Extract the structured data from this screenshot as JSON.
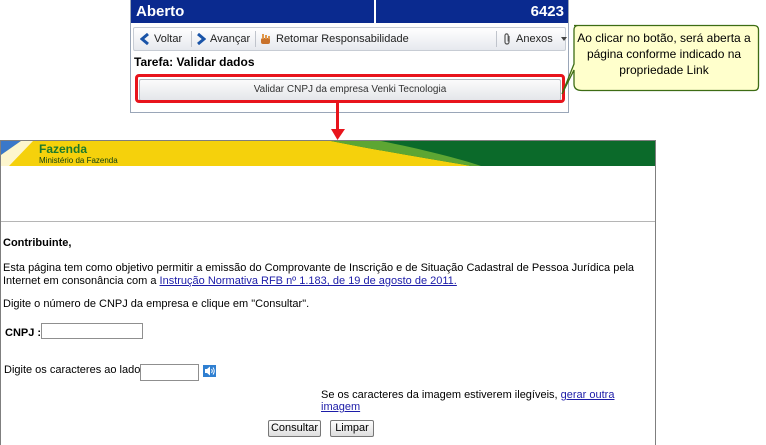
{
  "status": {
    "state": "Aberto",
    "number": "6423"
  },
  "toolbar": {
    "back_label": "Voltar",
    "forward_label": "Avançar",
    "resume_label": "Retomar Responsabilidade",
    "attachments_label": "Anexos"
  },
  "task": {
    "title": "Tarefa: Validar dados",
    "link_button_label": "Validar CNPJ da empresa Venki Tecnologia"
  },
  "callout": {
    "text": "Ao clicar no botão, será aberta a página conforme indicado na propriedade Link"
  },
  "gov": {
    "brand": "Fazenda",
    "ministry": "Ministério da Fazenda",
    "greeting": "Contribuinte,",
    "intro_before": "Esta página tem como objetivo permitir a emissão do Comprovante de Inscrição e de Situação Cadastral de Pessoa Jurídica pela Internet em consonância com a ",
    "intro_link": "Instrução Normativa RFB nº 1.183, de 19 de agosto de 2011.",
    "instruction": "Digite o número de CNPJ da empresa e clique em \"Consultar\".",
    "cnpj_label": "CNPJ :",
    "cnpj_value": "",
    "captcha_label": "Digite os caracteres ao lado:",
    "captcha_value": "",
    "illegible_text": "Se os caracteres da imagem estiverem ilegíveis, ",
    "illegible_link": "gerar outra imagem",
    "consultar_label": "Consultar",
    "limpar_label": "Limpar"
  },
  "colors": {
    "status_bar": "#0a2a8f",
    "highlight": "#e8141c",
    "callout_bg": "#ffffcc",
    "callout_border": "#3d6c14",
    "gov_green": "#1d7a2b",
    "gov_yellow": "#f5d10c",
    "link": "#1c1ca8"
  }
}
